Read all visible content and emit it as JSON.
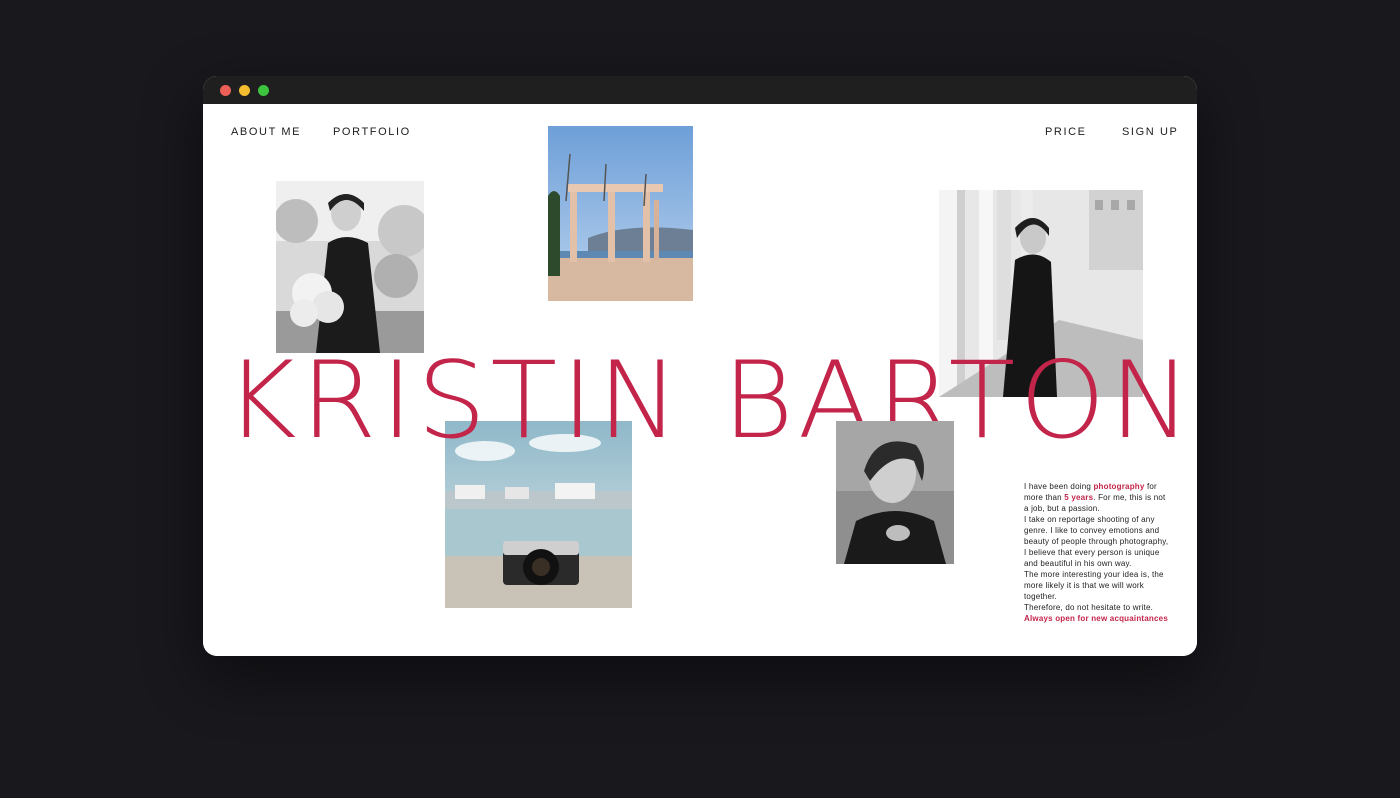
{
  "window": {
    "controls": [
      "close",
      "minimize",
      "maximize"
    ]
  },
  "nav": {
    "about": "ABOUT ME",
    "portfolio": "PORTFOLIO",
    "price": "PRICE",
    "signup": "SIGN UP"
  },
  "hero": {
    "name": "KRISTIN BARTON"
  },
  "bio": {
    "l1_a": "I have been doing ",
    "l1_hl": "photography",
    "l1_b": " for more than ",
    "l1_hl2": "5 years",
    "l1_c": ". For me, this is not a job, but a passion.",
    "p2": "I take on reportage shooting of any genre. I like to convey emotions and beauty of people through photography, I believe that every person is unique and beautiful in his own way.",
    "p3": "The more interesting your idea is, the more likely it is that we will work together.",
    "p4": "Therefore, do not hesitate to write.",
    "cta": "Always open for new acquaintances"
  },
  "colors": {
    "accent": "#c3244a",
    "background": "#18181d",
    "page": "#ffffff",
    "titlebar": "#1f1f1f"
  },
  "images": [
    {
      "name": "portrait-with-flowers",
      "kind": "black-and-white photo"
    },
    {
      "name": "seaside-colonnade",
      "kind": "color photo"
    },
    {
      "name": "portrait-walking-colonnade",
      "kind": "black-and-white photo"
    },
    {
      "name": "camera-on-pier",
      "kind": "color photo"
    },
    {
      "name": "close-portrait",
      "kind": "black-and-white photo"
    }
  ]
}
